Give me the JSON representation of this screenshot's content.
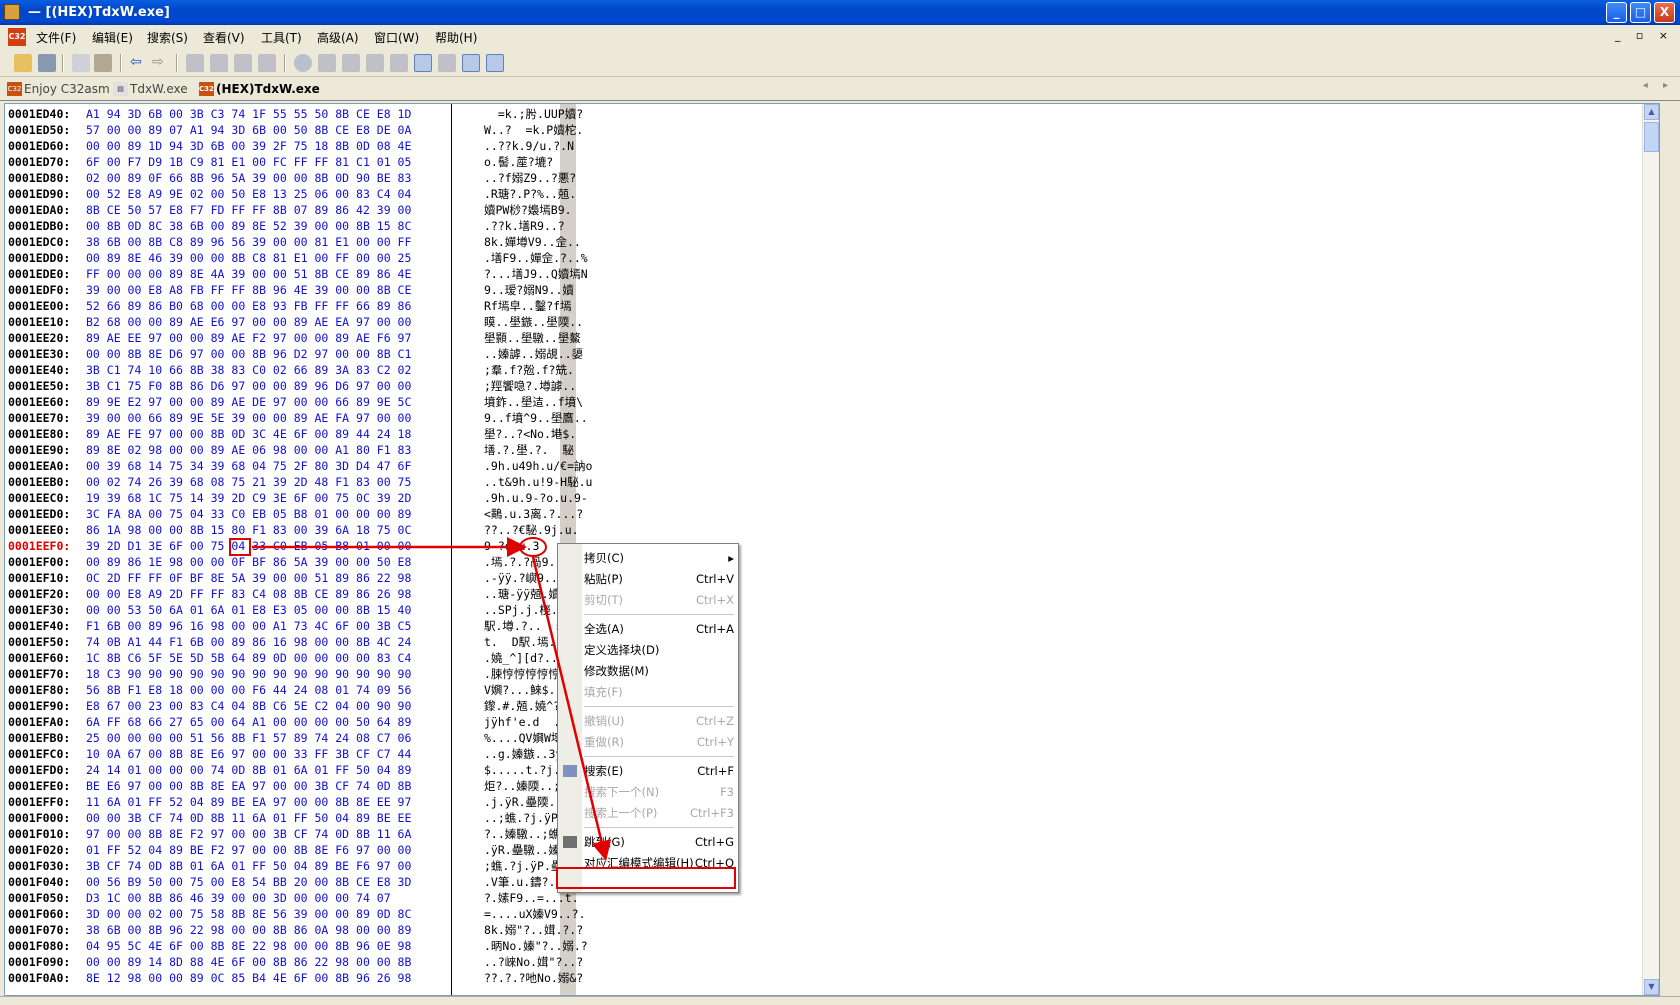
{
  "window": {
    "title": "— [(HEX)TdxW.exe]",
    "min": "_",
    "max": "□",
    "close": "X"
  },
  "menu": [
    "文件(F)",
    "编辑(E)",
    "搜索(S)",
    "查看(V)",
    "工具(T)",
    "高级(A)",
    "窗口(W)",
    "帮助(H)"
  ],
  "tabs": [
    {
      "label": "Enjoy C32asm"
    },
    {
      "label": "TdxW.exe"
    },
    {
      "label": "(HEX)TdxW.exe"
    }
  ],
  "rows": [
    {
      "addr": "0001ED40:",
      "hex": "A1 94 3D 6B 00 3B C3 74 1F 55 55 50 8B CE E8 1D",
      "asc": "  =k.;肹.UUP嬻?"
    },
    {
      "addr": "0001ED50:",
      "hex": "57 00 00 89 07 A1 94 3D 6B 00 50 8B CE E8 DE 0A",
      "asc": "W..?  =k.P嬻柁."
    },
    {
      "addr": "0001ED60:",
      "hex": "00 00 89 1D 94 3D 6B 00 39 2F 75 18 8B 0D 08 4E",
      "asc": "..??k.9/u.?.N"
    },
    {
      "addr": "0001ED70:",
      "hex": "6F 00 F7 D9 1B C9 81 E1 00 FC FF FF 81 C1 01 05",
      "asc": "o.髻.蓙?塶?"
    },
    {
      "addr": "0001ED80:",
      "hex": "02 00 89 0F 66 8B 96 5A 39 00 00 8B 0D 90 BE 83",
      "asc": "..?f嫋Z9..?悪?"
    },
    {
      "addr": "0001ED90:",
      "hex": "00 52 E8 A9 9E 02 00 50 E8 13 25 06 00 83 C4 04",
      "asc": ".R瑭?.P?%..兡."
    },
    {
      "addr": "0001EDA0:",
      "hex": "8B CE 50 57 E8 F7 FD FF FF 8B 07 89 86 42 39 00",
      "asc": "嬻PW桫?嬝墕B9."
    },
    {
      "addr": "0001EDB0:",
      "hex": "00 8B 0D 8C 38 6B 00 89 8E 52 39 00 00 8B 15 8C",
      "asc": ".??k.墡R9..?"
    },
    {
      "addr": "0001EDC0:",
      "hex": "38 6B 00 8B C8 89 96 56 39 00 00 81 E1 00 00 FF",
      "asc": "8k.嬋墫V9..佱.."
    },
    {
      "addr": "0001EDD0:",
      "hex": "00 89 8E 46 39 00 00 8B C8 81 E1 00 FF 00 00 25",
      "asc": ".墡F9..嬋佱.?..%"
    },
    {
      "addr": "0001EDE0:",
      "hex": "FF 00 00 00 89 8E 4A 39 00 00 51 8B CE 89 86 4E",
      "asc": "?...墡J9..Q嬻墕N"
    },
    {
      "addr": "0001EDF0:",
      "hex": "39 00 00 E8 A8 FB FF FF 8B 96 4E 39 00 00 8B CE",
      "asc": "9..瑷?嫋N9..嬻"
    },
    {
      "addr": "0001EE00:",
      "hex": "52 66 89 86 B0 68 00 00 E8 93 FB FF FF 66 89 86",
      "asc": "Rf墕皁..鑿?f墕"
    },
    {
      "addr": "0001EE10:",
      "hex": "B2 68 00 00 89 AE E6 97 00 00 89 AE EA 97 00 00",
      "asc": "瞙..壆鏃..壆陾.."
    },
    {
      "addr": "0001EE20:",
      "hex": "89 AE EE 97 00 00 89 AE F2 97 00 00 89 AE F6 97",
      "asc": "壆顥..壆驐..壆鰲"
    },
    {
      "addr": "0001EE30:",
      "hex": "00 00 8B 8E D6 97 00 00 8B 96 D2 97 00 00 8B C1",
      "asc": "..嫀謼..嫋覘..嬃"
    },
    {
      "addr": "0001EE40:",
      "hex": "3B C1 74 10 66 8B 38 83 C0 02 66 89 3A 83 C2 02",
      "asc": ";羣.f?兝.f?兟."
    },
    {
      "addr": "0001EE50:",
      "hex": "3B C1 75 F0 8B 86 D6 97 00 00 89 96 D6 97 00 00",
      "asc": ";羥饗喼?.墫謼.."
    },
    {
      "addr": "0001EE60:",
      "hex": "89 9E E2 97 00 00 89 AE DE 97 00 00 66 89 9E 5C",
      "asc": "墳鈼..壆迼..f墳\\"
    },
    {
      "addr": "0001EE70:",
      "hex": "39 00 00 66 89 9E 5E 39 00 00 89 AE FA 97 00 00",
      "asc": "9..f墳^9..壆鷹.."
    },
    {
      "addr": "0001EE80:",
      "hex": "89 AE FE 97 00 00 8B 0D 3C 4E 6F 00 89 44 24 18",
      "asc": "壆?..?<No.塂$."
    },
    {
      "addr": "0001EE90:",
      "hex": "89 8E 02 98 00 00 89 AE 06 98 00 00 A1 80 F1 83",
      "asc": "墡.?.壆.?.  駜"
    },
    {
      "addr": "0001EEA0:",
      "hex": "00 39 68 14 75 34 39 68 04 75 2F 80 3D D4 47 6F",
      "asc": ".9h.u49h.u/€=訥o"
    },
    {
      "addr": "0001EEB0:",
      "hex": "00 02 74 26 39 68 08 75 21 39 2D 48 F1 83 00 75",
      "asc": "..t&9h.u!9-H駜.u"
    },
    {
      "addr": "0001EEC0:",
      "hex": "19 39 68 1C 75 14 39 2D C9 3E 6F 00 75 0C 39 2D",
      "asc": ".9h.u.9-?o.u.9-"
    },
    {
      "addr": "0001EED0:",
      "hex": "3C FA 8A 00 75 04 33 C0 EB 05 B8 01 00 00 00 89",
      "asc": "<鷬.u.3离.?...?"
    },
    {
      "addr": "0001EEE0:",
      "hex": "86 1A 98 00 00 8B 15 80 F1 83 00 39 6A 18 75 0C",
      "asc": "??..?€駜.9j.u."
    },
    {
      "addr": "0001EEF0:",
      "hex": "39 2D D1 3E 6F 00 75 04 33 C0 EB 05 B8 01 00 00",
      "asc": "9-?o.u.3",
      "cur": true
    },
    {
      "addr": "0001EF00:",
      "hex": "00 89 86 1E 98 00 00 0F BF 86 5A 39 00 00 50 E8",
      "asc": ".墕.?.?咼9..P?"
    },
    {
      "addr": "0001EF10:",
      "hex": "0C 2D FF FF 0F BF 8E 5A 39 00 00 51 89 86 22 98",
      "asc": ".-ÿÿ.?嶼9..Q墕\"?"
    },
    {
      "addr": "0001EF20:",
      "hex": "00 00 E8 A9 2D FF FF 83 C4 08 8B CE 89 86 26 98",
      "asc": "..瑭-ÿÿ兡.嬻墕&?"
    },
    {
      "addr": "0001EF30:",
      "hex": "00 00 53 50 6A 01 6A 01 E8 E3 05 00 00 8B 15 40",
      "asc": "..SPj.j.桡...?@"
    },
    {
      "addr": "0001EF40:",
      "hex": "F1 6B 00 89 96 16 98 00 00 A1 73 4C 6F 00 3B C5",
      "asc": "駅.墫.?..  sLo.;?"
    },
    {
      "addr": "0001EF50:",
      "hex": "74 0B A1 44 F1 6B 00 89 86 16 98 00 00 8B 4C 24",
      "asc": "t.  D駅.墕.?..婰$"
    },
    {
      "addr": "0001EF60:",
      "hex": "1C 8B C6 5F 5E 5D 5B 64 89 0D 00 00 00 00 83 C4",
      "asc": ".嬈_^][d?....兡"
    },
    {
      "addr": "0001EF70:",
      "hex": "18 C3 90 90 90 90 90 90 90 90 90 90 90 90 90 90",
      "asc": ".脨悙悙悙悙悙悙悙"
    },
    {
      "addr": "0001EF80:",
      "hex": "56 8B F1 E8 18 00 00 00 F6 44 24 08 01 74 09 56",
      "asc": "V嬹?...鯠$..t.V"
    },
    {
      "addr": "0001EF90:",
      "hex": "E8 67 00 23 00 83 C4 04 8B C6 5E C2 04 00 90 90",
      "asc": "鑗.#.兡.嬈^?.悙"
    },
    {
      "addr": "0001EFA0:",
      "hex": "6A FF 68 66 27 65 00 64 A1 00 00 00 00 50 64 89",
      "asc": "jÿhf'e.d  ....Pd?"
    },
    {
      "addr": "0001EFB0:",
      "hex": "25 00 00 00 00 51 56 8B F1 57 89 74 24 08 C7 06",
      "asc": "%....QV嬹W塼$.?"
    },
    {
      "addr": "0001EFC0:",
      "hex": "10 0A 67 00 8B 8E E6 97 00 00 33 FF 3B CF C7 44",
      "asc": "..g.嫀鏃..3ÿ;锨D"
    },
    {
      "addr": "0001EFD0:",
      "hex": "24 14 01 00 00 00 74 0D 8B 01 6A 01 FF 50 04 89",
      "asc": "$.....t.?j.ÿP.?"
    },
    {
      "addr": "0001EFE0:",
      "hex": "BE E6 97 00 00 8B 8E EA 97 00 00 3B CF 74 0D 8B",
      "asc": "炬?..嫀陾..;蟭.?"
    },
    {
      "addr": "0001EFF0:",
      "hex": "11 6A 01 FF 52 04 89 BE EA 97 00 00 8B 8E EE 97",
      "asc": ".j.ÿR.壘陾..嫀顥"
    },
    {
      "addr": "0001F000:",
      "hex": "00 00 3B CF 74 0D 8B 11 6A 01 FF 50 04 89 BE EE",
      "asc": "..;蟭.?j.ÿP.壘"
    },
    {
      "addr": "0001F010:",
      "hex": "97 00 00 8B 8E F2 97 00 00 3B CF 74 0D 8B 11 6A",
      "asc": "?..嫀驐..;蟭.?j"
    },
    {
      "addr": "0001F020:",
      "hex": "01 FF 52 04 89 BE F2 97 00 00 8B 8E F6 97 00 00",
      "asc": ".ÿR.壘驐..嫀鰲.."
    },
    {
      "addr": "0001F030:",
      "hex": "3B CF 74 0D 8B 01 6A 01 FF 50 04 89 BE F6 97 00",
      "asc": ";蟭.?j.ÿP.壘鰲."
    },
    {
      "addr": "0001F040:",
      "hex": "00 56 B9 50 00 75 00 E8 54 BB 20 00 8B CE E8 3D",
      "asc": ".V筆.u.鑄?.嬻?="
    },
    {
      "addr": "0001F050:",
      "hex": "D3 1C 00 8B 86 46 39 00 00 3D 00 00 00 74 07",
      "asc": "?.嫊F9..=...t."
    },
    {
      "addr": "0001F060:",
      "hex": "3D 00 00 02 00 75 58 8B 8E 56 39 00 00 89 0D 8C",
      "asc": "=....uX嫀V9..?."
    },
    {
      "addr": "0001F070:",
      "hex": "38 6B 00 8B 96 22 98 00 00 8B 86 0A 98 00 00 89",
      "asc": "8k.嫋\"?..媶.?.?"
    },
    {
      "addr": "0001F080:",
      "hex": "04 95 5C 4E 6F 00 8B 8E 22 98 00 00 8B 96 0E 98",
      "asc": ".昞No.嫀\"?..嫋.?"
    },
    {
      "addr": "0001F090:",
      "hex": "00 00 89 14 8D 88 4E 6F 00 8B 86 22 98 00 00 8B",
      "asc": "..?崍No.媶\"?..?"
    },
    {
      "addr": "0001F0A0:",
      "hex": "8E 12 98 00 00 89 0C 85 B4 4E 6F 00 8B 96 26 98",
      "asc": "??.?.?吔No.嫋&?"
    }
  ],
  "context_menu": [
    {
      "label": "拷贝(C)",
      "key": "",
      "sub": true,
      "dis": false
    },
    {
      "label": "粘贴(P)",
      "key": "Ctrl+V",
      "dis": false
    },
    {
      "label": "剪切(T)",
      "key": "Ctrl+X",
      "dis": true
    },
    {
      "label": "全选(A)",
      "key": "Ctrl+A",
      "dis": false
    },
    {
      "label": "定义选择块(D)",
      "key": "",
      "dis": false
    },
    {
      "label": "修改数据(M)",
      "key": "",
      "dis": false
    },
    {
      "label": "填充(F)",
      "key": "",
      "dis": true
    },
    {
      "label": "撤销(U)",
      "key": "Ctrl+Z",
      "dis": true
    },
    {
      "label": "重做(R)",
      "key": "Ctrl+Y",
      "dis": true
    },
    {
      "label": "搜索(E)",
      "key": "Ctrl+F",
      "dis": false
    },
    {
      "label": "搜索下一个(N)",
      "key": "F3",
      "dis": true
    },
    {
      "label": "搜索上一个(P)",
      "key": "Ctrl+F3",
      "dis": true
    },
    {
      "label": "跳到(G)",
      "key": "Ctrl+G",
      "dis": false
    },
    {
      "label": "对应汇编模式编辑(H)",
      "key": "Ctrl+Q",
      "dis": false
    }
  ],
  "highlight_byte": "75",
  "colors": {
    "accent": "#e00000",
    "hex": "#1010d0"
  }
}
